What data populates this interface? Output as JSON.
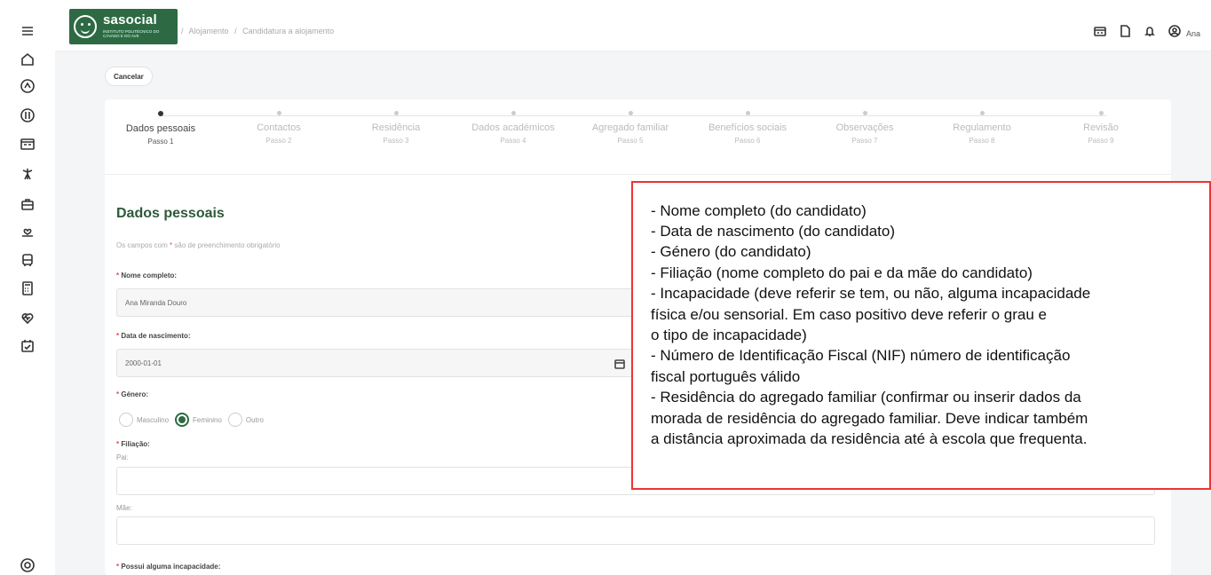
{
  "header": {
    "logo_name": "sasocial",
    "logo_sub": "INSTITUTO POLITÉCNICO DO CÁVADO E DO AVE",
    "breadcrumb": [
      "/",
      "Alojamento",
      "/",
      "Candidatura a alojamento"
    ],
    "user": "Ana"
  },
  "rail_icons": [
    "menu-icon",
    "home-icon",
    "map-pin-icon",
    "food-icon",
    "card-icon",
    "antenna-icon",
    "briefcase-icon",
    "care-icon",
    "bus-icon",
    "calculator-icon",
    "health-icon",
    "calendar-icon",
    "settings-icon"
  ],
  "actions": {
    "cancel": "Cancelar"
  },
  "steps": [
    {
      "label": "Dados pessoais",
      "sub": "Passo 1"
    },
    {
      "label": "Contactos",
      "sub": "Passo 2"
    },
    {
      "label": "Residência",
      "sub": "Passo 3"
    },
    {
      "label": "Dados académicos",
      "sub": "Passo 4"
    },
    {
      "label": "Agregado familiar",
      "sub": "Passo 5"
    },
    {
      "label": "Benefícios sociais",
      "sub": "Passo 6"
    },
    {
      "label": "Observações",
      "sub": "Passo 7"
    },
    {
      "label": "Regulamento",
      "sub": "Passo 8"
    },
    {
      "label": "Revisão",
      "sub": "Passo 9"
    }
  ],
  "active_step": 1,
  "form": {
    "title": "Dados pessoais",
    "req_note_pre": "Os campos com",
    "req_note_ast": "*",
    "req_note_post": "são de preenchimento obrigatório",
    "ast": "*",
    "name_label": "Nome completo",
    "name_value": "Ana  Miranda Douro",
    "birth_label": "Data de nascimento",
    "birth_value": "2000-01-01",
    "gender_label": "Género",
    "gender_options": [
      "Masculino",
      "Feminino",
      "Outro"
    ],
    "gender_selected": "Feminino",
    "filiation_label": "Filiação",
    "father_label": "Pai:",
    "mother_label": "Mãe:",
    "incapacity_label": "Possui alguma incapacidade"
  },
  "annotation": {
    "lines": [
      "- Nome completo (do candidato)",
      "- Data de nascimento (do candidato)",
      "- Género (do candidato)",
      "- Filiação (nome completo do pai e da mãe do candidato)",
      "- Incapacidade (deve referir se tem, ou não, alguma incapacidade",
      "física e/ou sensorial. Em caso positivo deve referir o grau e",
      "o tipo de incapacidade)",
      "- Número de Identificação Fiscal (NIF) número de identificação",
      "fiscal português válido",
      "- Residência do agregado familiar (confirmar ou inserir dados da",
      "morada de residência do agregado familiar. Deve indicar também",
      "a distância aproximada da residência até à escola que frequenta."
    ]
  },
  "colors": {
    "brand": "#2d6a43",
    "required": "#e04f4f",
    "annotation_border": "#e33333"
  }
}
